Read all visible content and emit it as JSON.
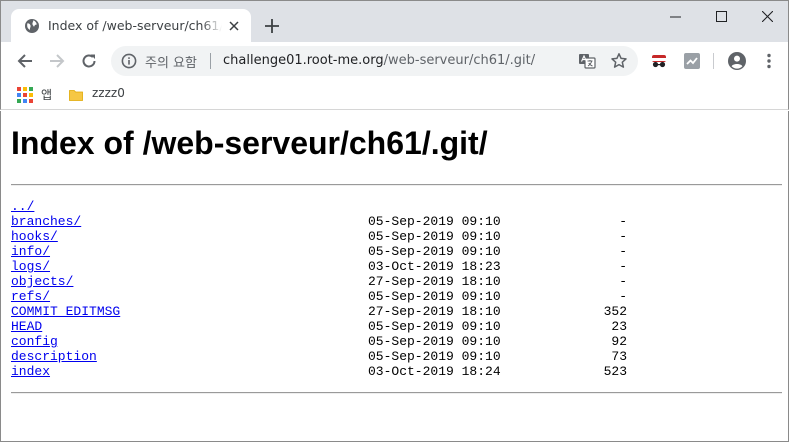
{
  "browser": {
    "tab": {
      "title": "Index of /web-serveur/ch61/.git/"
    },
    "omnibox": {
      "security_status": "주의 요함",
      "url_host": "challenge01.root-me.org",
      "url_path": "/web-serveur/ch61/.git/"
    },
    "bookmarks": {
      "apps_label": "앱",
      "folder_label": "zzzz0"
    },
    "colors": {
      "tab_strip": "#dee1e6",
      "omnibox": "#f1f3f4",
      "link": "#0000ee",
      "icon": "#5f6368"
    }
  },
  "page": {
    "title": "Index of /web-serveur/ch61/.git/",
    "parent_link": "../",
    "entries": [
      {
        "name": "branches/",
        "date": "05-Sep-2019 09:10",
        "size": "-"
      },
      {
        "name": "hooks/",
        "date": "05-Sep-2019 09:10",
        "size": "-"
      },
      {
        "name": "info/",
        "date": "05-Sep-2019 09:10",
        "size": "-"
      },
      {
        "name": "logs/",
        "date": "03-Oct-2019 18:23",
        "size": "-"
      },
      {
        "name": "objects/",
        "date": "27-Sep-2019 18:10",
        "size": "-"
      },
      {
        "name": "refs/",
        "date": "05-Sep-2019 09:10",
        "size": "-"
      },
      {
        "name": "COMMIT_EDITMSG",
        "date": "27-Sep-2019 18:10",
        "size": "352"
      },
      {
        "name": "HEAD",
        "date": "05-Sep-2019 09:10",
        "size": "23"
      },
      {
        "name": "config",
        "date": "05-Sep-2019 09:10",
        "size": "92"
      },
      {
        "name": "description",
        "date": "05-Sep-2019 09:10",
        "size": "73"
      },
      {
        "name": "index",
        "date": "03-Oct-2019 18:24",
        "size": "523"
      }
    ]
  }
}
